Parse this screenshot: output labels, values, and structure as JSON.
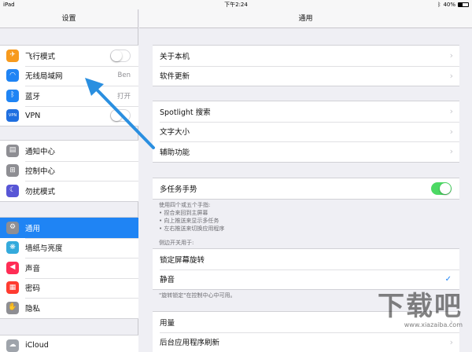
{
  "statusbar": {
    "device": "iPad",
    "time": "下午2:24",
    "battery": "40%",
    "battery_level": 0.4
  },
  "sidebar": {
    "title": "设置",
    "group1": [
      {
        "label": "飞行模式",
        "icon": "airplane-icon",
        "icon_glyph": "✈",
        "icon_color": "#f79a1e",
        "toggle": false
      },
      {
        "label": "无线局域网",
        "icon": "wifi-icon",
        "icon_glyph": "◠",
        "icon_color": "#1f84f4",
        "value": "Ben"
      },
      {
        "label": "蓝牙",
        "icon": "bluetooth-icon",
        "icon_glyph": "ᛒ",
        "icon_color": "#1f84f4",
        "value": "打开"
      },
      {
        "label": "VPN",
        "icon": "vpn-icon",
        "icon_glyph": "VPN",
        "icon_color": "#1f6fe0",
        "toggle": false
      }
    ],
    "group2": [
      {
        "label": "通知中心",
        "icon": "notification-center-icon",
        "icon_glyph": "▤",
        "icon_color": "#8e8e93"
      },
      {
        "label": "控制中心",
        "icon": "control-center-icon",
        "icon_glyph": "⊞",
        "icon_color": "#8e8e93"
      },
      {
        "label": "勿扰模式",
        "icon": "do-not-disturb-icon",
        "icon_glyph": "☾",
        "icon_color": "#5856d6"
      }
    ],
    "group3": [
      {
        "label": "通用",
        "icon": "gear-icon",
        "icon_glyph": "⚙",
        "icon_color": "#8e8e93",
        "selected": true
      },
      {
        "label": "墙纸与亮度",
        "icon": "wallpaper-icon",
        "icon_glyph": "❋",
        "icon_color": "#34aadc"
      },
      {
        "label": "声音",
        "icon": "sound-icon",
        "icon_glyph": "◀",
        "icon_color": "#ff2d55"
      },
      {
        "label": "密码",
        "icon": "passcode-icon",
        "icon_glyph": "▦",
        "icon_color": "#ff3b30"
      },
      {
        "label": "隐私",
        "icon": "privacy-icon",
        "icon_glyph": "✋",
        "icon_color": "#8e8e93"
      }
    ],
    "group4": [
      {
        "label": "iCloud",
        "icon": "icloud-icon",
        "icon_glyph": "☁",
        "icon_color": "#9fa4ab"
      }
    ]
  },
  "main": {
    "title": "通用",
    "group1": [
      "关于本机",
      "软件更新"
    ],
    "group2": [
      "Spotlight 搜索",
      "文字大小",
      "辅助功能"
    ],
    "multitask": {
      "label": "多任务手势",
      "on": true
    },
    "multitask_note": [
      "使用四个或五个手指:",
      "• 捏合来回到主屏幕",
      "• 向上推送来显示多任务",
      "• 左右推送来切换应用程序"
    ],
    "side_switch_header": "侧边开关用于:",
    "side_switch_options": [
      {
        "label": "锁定屏幕旋转",
        "checked": false
      },
      {
        "label": "静音",
        "checked": true
      }
    ],
    "side_switch_note": "\"旋转锁定\"在控制中心中可用。",
    "group5": [
      "用量",
      "后台应用程序刷新"
    ]
  },
  "watermark": {
    "big": "下载吧",
    "small": "www.xiazaiba.com"
  },
  "colors": {
    "accent": "#1f84f4",
    "toggle_on": "#4cd964",
    "arrow": "#2a8fe0"
  }
}
